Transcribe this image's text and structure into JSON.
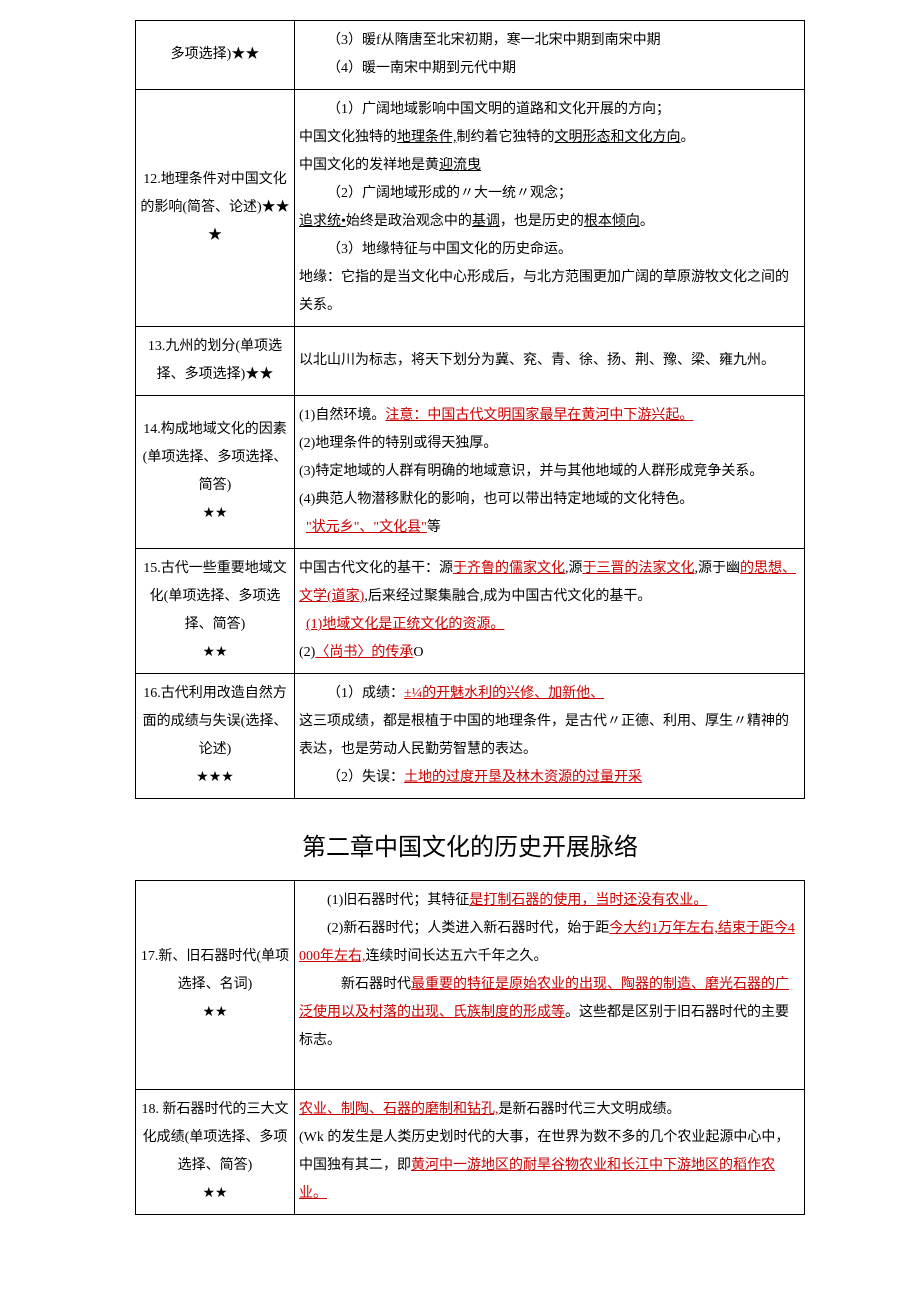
{
  "table1": {
    "rows": [
      {
        "left": "多项选择)★★",
        "right": "（3）暖f从隋唐至北宋初期，寒一北宋中期到南宋中期\n（4）暖一南宋中期到元代中期"
      },
      {
        "left": "12.地理条件对中国文化的影响(简答、论述)★★★",
        "right_full": true
      },
      {
        "left": "13.九州的划分(单项选择、多项选择)★★",
        "right": "以北山川为标志，将天下划分为冀、兖、青、徐、扬、荆、豫、梁、雍九州。"
      },
      {
        "left": "14.构成地域文化的因素(单项选择、多项选择、简答)\n★★",
        "right_full": true
      },
      {
        "left": "15.古代一些重要地域文化(单项选择、多项选择、简答)\n★★",
        "right_full": true
      },
      {
        "left": "16.古代利用改造自然方面的成绩与失误(选择、论述)\n★★★",
        "right_full": true
      }
    ],
    "r12": {
      "p1a": "（1）广阔地域影响中国文明的道路和文化开展的方向；",
      "p1b_pre": "中国文化独特的",
      "p1b_u1": "地理条件,",
      "p1b_mid": "制约着它独特的",
      "p1b_u2": "文明形态和文化方向",
      "p1b_post": "。",
      "p1c_pre": "中国文化的发祥地是黄",
      "p1c_u": "迎流曳",
      "p2": "（2）广阔地域形成的〃大一统〃观念；",
      "p2b_u1": "追求统•",
      "p2b_mid": "始终是政治观念中的",
      "p2b_u2": "基调",
      "p2b_mid2": "，也是历史的",
      "p2b_u3": "根本倾向",
      "p2b_post": "。",
      "p3": "（3）地缘特征与中国文化的历史命运。",
      "p3b": "地缘：它指的是当文化中心形成后，与北方范围更加广阔的草原游牧文化之间的关系。"
    },
    "r14": {
      "p1_pre": "(1)自然环境。",
      "p1_u": "注意：中国古代文明国家最早在黄河中下游兴起。",
      "p2": "(2)地理条件的特别或得天独厚。",
      "p3": "(3)特定地域的人群有明确的地域意识，并与其他地域的人群形成竞争关系。",
      "p4": "(4)典范人物潜移默化的影响，也可以带出特定地域的文化特色。",
      "p5_u1": "\"状元乡\"、\"文化县\"",
      "p5_post": "等"
    },
    "r15": {
      "p1_pre": "中国古代文化的基干：源",
      "p1_u1": "于齐鲁的儒家文化",
      "p1_mid1": ",源",
      "p1_u2": "于三晋的法家文化",
      "p1_mid2": ",源于幽",
      "p1_u3": "的思想、文学(道家)",
      "p1_post": ",后来经过聚集融合,成为中国古代文化的基干。",
      "p2": "(1)地域文化是正统文化的资源。",
      "p3_pre": "(2)",
      "p3_u": "〈尚书〉的传承",
      "p3_post": "O"
    },
    "r16": {
      "p1_pre": "（1）成绩：",
      "p1_u": "±¼的开魅水利的兴修、加新他、",
      "p2": "这三项成绩，都是根植于中国的地理条件，是古代〃正德、利用、厚生〃精神的表达，也是劳动人民勤劳智慧的表达。",
      "p3_pre": "（2）失误：",
      "p3_u": "土地的过度开垦及林木资源的过量开采"
    }
  },
  "chapter_title": "第二章中国文化的历史开展脉络",
  "table2": {
    "r17": {
      "left": "17.新、旧石器时代(单项选择、名词)\n★★",
      "p1_pre": "(1)旧石器时代；其特征",
      "p1_u": "是打制石器的使用，当时还没有农业。",
      "p2_pre": "(2)新石器时代；人类进入新石器时代，始于距",
      "p2_u1": "今大约1万年左右,结束于距今4000年左右,",
      "p2_mid": "连续时间长达五六千年之久。",
      "p3_pre": "新石器时代",
      "p3_u": "最重要的特征是原始农业的出现、陶器的制造、磨光石器的广泛使用以及村落的出现、氏族制度的形成等",
      "p3_post": "。这些都是区别于旧石器时代的主要标志。"
    },
    "r18": {
      "left": "18. 新石器时代的三大文化成绩(单项选择、多项选择、简答)\n★★",
      "p1_u": "农业、制陶、石器的磨制和钻孔,",
      "p1_post": "是新石器时代三大文明成绩。",
      "p2_pre": "(Wk 的发生是人类历史划时代的大事，在世界为数不多的几个农业起源中心中，中国独有其二，即",
      "p2_u1": "黄河中一游地区的耐旱谷物农业和长江中下游地区的稻作农业。"
    }
  }
}
